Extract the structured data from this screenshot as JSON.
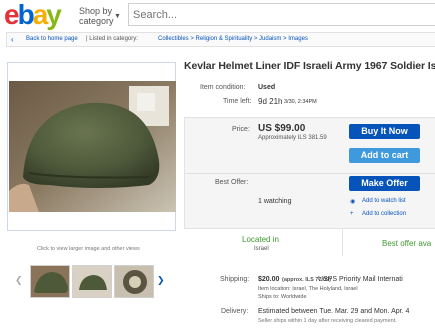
{
  "logo": {
    "letters": [
      "e",
      "b",
      "a",
      "y"
    ],
    "colors": [
      "#e53238",
      "#0064d2",
      "#f5af02",
      "#86b817"
    ]
  },
  "header": {
    "shop_by": "Shop by category",
    "search_placeholder": "Search..."
  },
  "breadcrumb": {
    "back": "Back to home page",
    "listed_in": "| Listed in category:",
    "categories": "Collectibles > Religion & Spirituality > Judaism > Images"
  },
  "image": {
    "view_larger": "Click to view larger image and other views"
  },
  "item": {
    "title": "Kevlar Helmet Liner IDF Israeli Army 1967 Soldier Isr",
    "condition_label": "Item condition:",
    "condition": "Used",
    "time_left_label": "Time left:",
    "time_left": "9d 21h",
    "time_left_date": "3/30, 2:34PM"
  },
  "price": {
    "label": "Price:",
    "amount": "US $99.00",
    "approx": "Approximately ILS 381.59",
    "buy_now": "Buy It Now",
    "add_to_cart": "Add to cart"
  },
  "offer": {
    "label": "Best Offer:",
    "button": "Make Offer",
    "watching": "1 watching",
    "add_watch": "Add to watch list",
    "add_collection": "Add to collection"
  },
  "location": {
    "heading": "Located in",
    "value": "Israel",
    "best_offer": "Best offer ava"
  },
  "shipping": {
    "label": "Shipping:",
    "amount": "$20.00",
    "approx": "(approx. ILS 77.09)",
    "service": "USPS Priority Mail Internati",
    "item_location": "Item location: Israel, The Holyland, Israel",
    "ships_to": "Ships to: Worldwide"
  },
  "delivery": {
    "label": "Delivery:",
    "estimate": "Estimated between Tue. Mar. 29 and Mon. Apr. 4",
    "note": "Seller ships within 1 day after receiving cleared payment."
  },
  "colors": {
    "link": "#0654ba",
    "buy": "#0654ba",
    "cart": "#3f99dd",
    "green": "#3c9a2d"
  }
}
